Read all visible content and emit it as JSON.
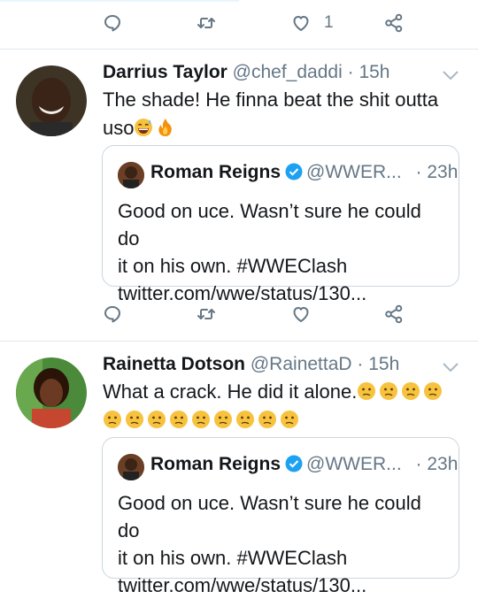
{
  "top_action_bar": {
    "like_count": "1"
  },
  "tweets": [
    {
      "name": "Darrius Taylor",
      "handle": "@chef_daddi",
      "separator": "·",
      "time": "15h",
      "text_line1": "The shade! He finna beat the shit outta",
      "text_line2": "uso",
      "emoji": [
        "grinning-sweat-emoji",
        "fire-emoji"
      ],
      "quote": {
        "name": "Roman Reigns",
        "handle": "@WWER...",
        "time": "· 23h",
        "line1": "Good on uce. Wasn’t sure he could do",
        "line2": "it on his own. #WWEClash",
        "line3": "twitter.com/wwe/status/130..."
      }
    },
    {
      "name": "Rainetta Dotson",
      "handle": "@RainettaD",
      "separator": "·",
      "time": "15h",
      "text_line1": "What a crack. He did it alone.",
      "emoji_count_line1": 4,
      "emoji_count_line2": 9,
      "emoji": [
        "confused-face-emoji"
      ],
      "quote": {
        "name": "Roman Reigns",
        "handle": "@WWER...",
        "time": "· 23h",
        "line1": "Good on uce. Wasn’t sure he could do",
        "line2": "it on his own. #WWEClash",
        "line3": "twitter.com/wwe/status/130..."
      }
    }
  ],
  "colors": {
    "icon": "#657786",
    "border": "#e1e8ed",
    "verified": "#1da1f2",
    "name": "#14171a"
  }
}
